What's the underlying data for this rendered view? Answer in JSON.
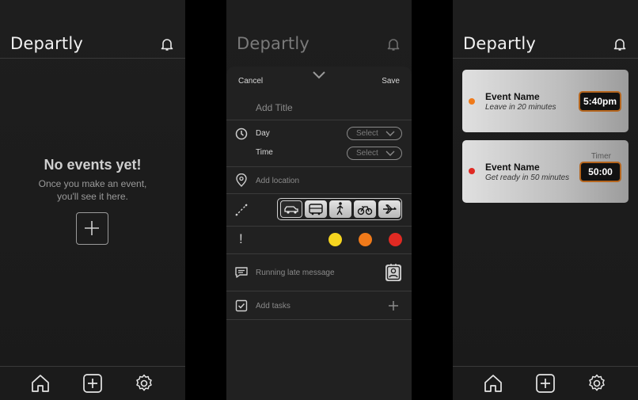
{
  "app": {
    "name": "Departly"
  },
  "empty_screen": {
    "title": "No events yet!",
    "subtitle_line1": "Once you make an event,",
    "subtitle_line2": "you'll see it here."
  },
  "form_screen": {
    "cancel_label": "Cancel",
    "save_label": "Save",
    "title_placeholder": "Add Title",
    "day_label": "Day",
    "time_label": "Time",
    "select_label": "Select",
    "location_placeholder": "Add location",
    "transport_options": [
      "car",
      "bus",
      "walk",
      "bike",
      "plane"
    ],
    "transport_selected": "car",
    "priority_mark": "!",
    "priority_colors": [
      "#f6d51f",
      "#f07a1a",
      "#e02a23"
    ],
    "late_message_placeholder": "Running late message",
    "tasks_placeholder": "Add tasks"
  },
  "events_screen": {
    "events": [
      {
        "name": "Event Name",
        "subtitle": "Leave in 20 minutes",
        "time": "5:40pm",
        "dot_color": "#f07a1a",
        "label": ""
      },
      {
        "name": "Event Name",
        "subtitle": "Get ready in 50 minutes",
        "time": "50:00",
        "dot_color": "#e02a23",
        "label": "Timer"
      }
    ]
  },
  "tabbar": {
    "items": [
      "home-icon",
      "add-icon",
      "settings-icon"
    ]
  }
}
